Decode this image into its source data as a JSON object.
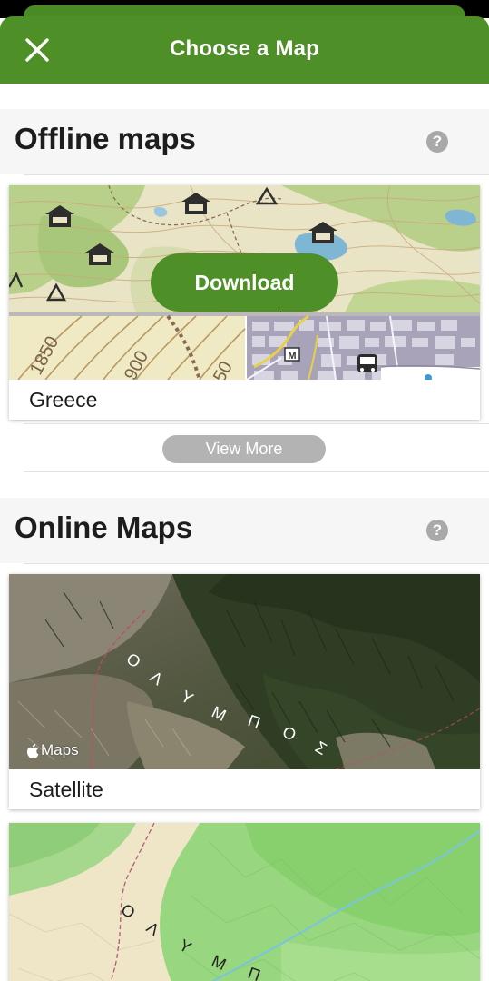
{
  "header": {
    "title": "Choose a Map",
    "close_icon": "close-icon"
  },
  "offline": {
    "title": "Offline maps",
    "help_glyph": "?",
    "card": {
      "name": "Greece",
      "download_label": "Download"
    },
    "view_more_label": "View More"
  },
  "online": {
    "title": "Online Maps",
    "help_glyph": "?",
    "satellite": {
      "name": "Satellite",
      "attribution": "Maps"
    }
  },
  "map_text": {
    "contour_a": "1850",
    "contour_b": "900",
    "contour_c": "50",
    "metro_glyph": "M",
    "greek_letters": [
      "Ο",
      "Λ",
      "Υ",
      "Μ",
      "Π",
      "Ο",
      "Σ"
    ]
  },
  "colors": {
    "brand_green": "#4f8f27",
    "help_gray": "#a9a9a9",
    "view_more_gray": "#b3b3b3"
  }
}
